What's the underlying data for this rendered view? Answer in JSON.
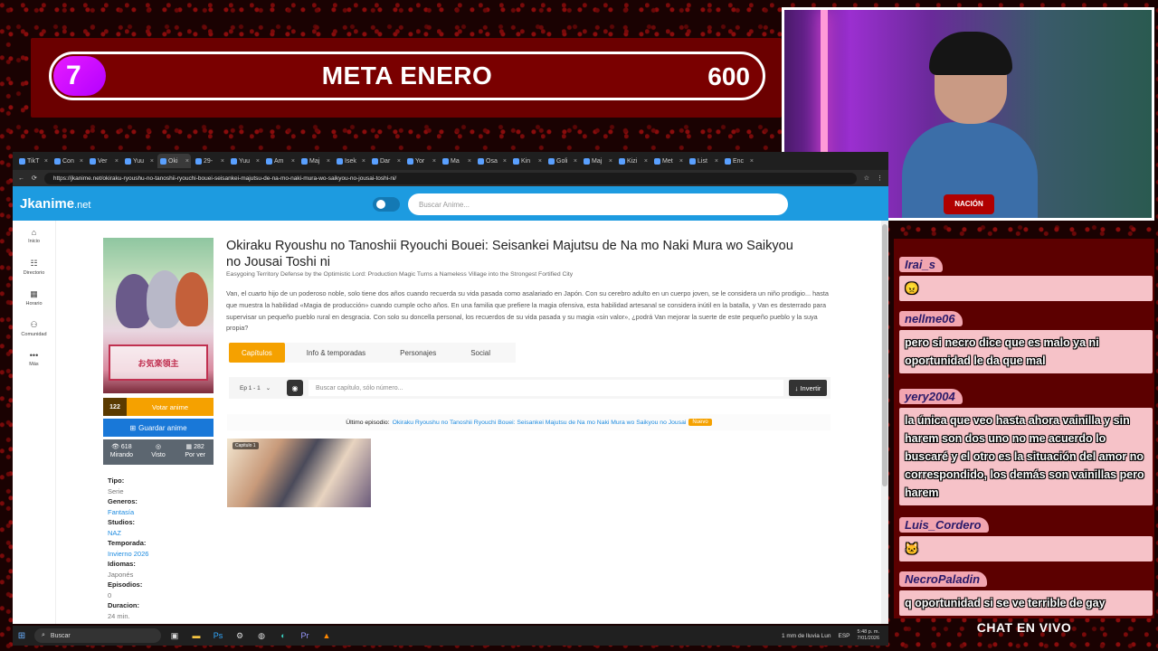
{
  "goal": {
    "count": "7",
    "title": "META ENERO",
    "target": "600"
  },
  "browser": {
    "tabs": [
      "TikT",
      "Con",
      "Ver",
      "Yuu",
      "Oki",
      "29-",
      "Yuu",
      "Am",
      "Maj",
      "Isek",
      "Dar",
      "Yor",
      "Ma",
      "Osa",
      "Kin",
      "Goli",
      "Maj",
      "Kizi",
      "Met",
      "List",
      "Enc"
    ],
    "active_tab_index": 4,
    "url": "https://jkanime.net/okiraku-ryoushu-no-tanoshii-ryouchi-bouei-seisankei-majutsu-de-na-mo-naki-mura-wo-saikyou-no-jousai-toshi-ni/"
  },
  "site": {
    "logo_main": "Jkanime",
    "logo_suffix": ".net",
    "search_placeholder": "Buscar Anime...",
    "nav": [
      {
        "icon": "⌂",
        "label": "Inicio"
      },
      {
        "icon": "☷",
        "label": "Directorio"
      },
      {
        "icon": "▦",
        "label": "Horario"
      },
      {
        "icon": "⚇",
        "label": "Comunidad"
      },
      {
        "icon": "•••",
        "label": "Más"
      }
    ]
  },
  "anime": {
    "title": "Okiraku Ryoushu no Tanoshii Ryouchi Bouei: Seisankei Majutsu de Na mo Naki Mura wo Saikyou no Jousai Toshi ni",
    "subtitle": "Easygoing Territory Defense by the Optimistic Lord: Production Magic Turns a Nameless Village into the Strongest Fortified City",
    "synopsis": "Van, el cuarto hijo de un poderoso noble, solo tiene dos años cuando recuerda su vida pasada como asalariado en Japón. Con su cerebro adulto en un cuerpo joven, se le considera un niño prodigio... hasta que muestra la habilidad «Magia de producción» cuando cumple ocho años. En una familia que prefiere la magia ofensiva, esta habilidad artesanal se considera inútil en la batalla, y Van es desterrado para supervisar un pequeño pueblo rural en desgracia. Con solo su doncella personal, los recuerdos de su vida pasada y su magia «sin valor», ¿podrá Van mejorar la suerte de este pequeño pueblo y la suya propia?",
    "vote_count": "122",
    "vote_label": "Votar anime",
    "save_label": "Guardar anime",
    "stats": [
      {
        "icon": "👁 618",
        "label": "Mirando"
      },
      {
        "icon": "◎",
        "label": "Visto"
      },
      {
        "icon": "▦ 282",
        "label": "Por ver"
      }
    ],
    "info": [
      {
        "label": "Tipo:",
        "value": "Serie",
        "link": false
      },
      {
        "label": "Generos:",
        "value": "Fantasía",
        "link": true
      },
      {
        "label": "Studios:",
        "value": "NAZ",
        "link": true
      },
      {
        "label": "Temporada:",
        "value": "Invierno 2026",
        "link": true
      },
      {
        "label": "Idiomas:",
        "value": "Japonés",
        "link": false
      },
      {
        "label": "Episodios:",
        "value": "0",
        "link": false
      },
      {
        "label": "Duracion:",
        "value": "24 min.",
        "link": false
      }
    ],
    "tabs": [
      "Capítulos",
      "Info & temporadas",
      "Personajes",
      "Social"
    ],
    "episode_range": "Ep 1 - 1",
    "episode_search_placeholder": "Buscar capítulo, sólo número...",
    "invert_label": "↓ Invertir",
    "last_episode_label": "Último episodio:",
    "last_episode_link": "Okiraku Ryoushu no Tanoshii Ryouchi Bouei: Seisankei Majutsu de Na mo Naki Mura wo Saikyou no Jousai",
    "new_badge": "Nuevo",
    "episode_card_label": "Capitulo 1"
  },
  "chat": {
    "messages": [
      {
        "user": "Irai_s",
        "text": "😠"
      },
      {
        "user": "nellme06",
        "text": "pero si necro dice que es malo ya ni oportunidad le da que mal"
      },
      {
        "user": "yery2004",
        "text": "la única que veo hasta ahora vainilla y sin harem son dos uno no me acuerdo lo buscaré y el otro es la situación del amor no correspondido, los demás son vainillas pero harem"
      },
      {
        "user": "Luis_Cordero",
        "text": "🐱"
      },
      {
        "user": "NecroPaladin",
        "text": "q oportunidad si se ve terrible de gay"
      }
    ],
    "footer": "CHAT EN VIVO"
  },
  "webcam": {
    "badge": "NACIÓN AKACHAN"
  },
  "taskbar": {
    "search": "Buscar",
    "weather": "1 mm de lluvia Lun",
    "lang": "ESP",
    "time": "5:48 p. m.",
    "date": "7/01/2026"
  }
}
